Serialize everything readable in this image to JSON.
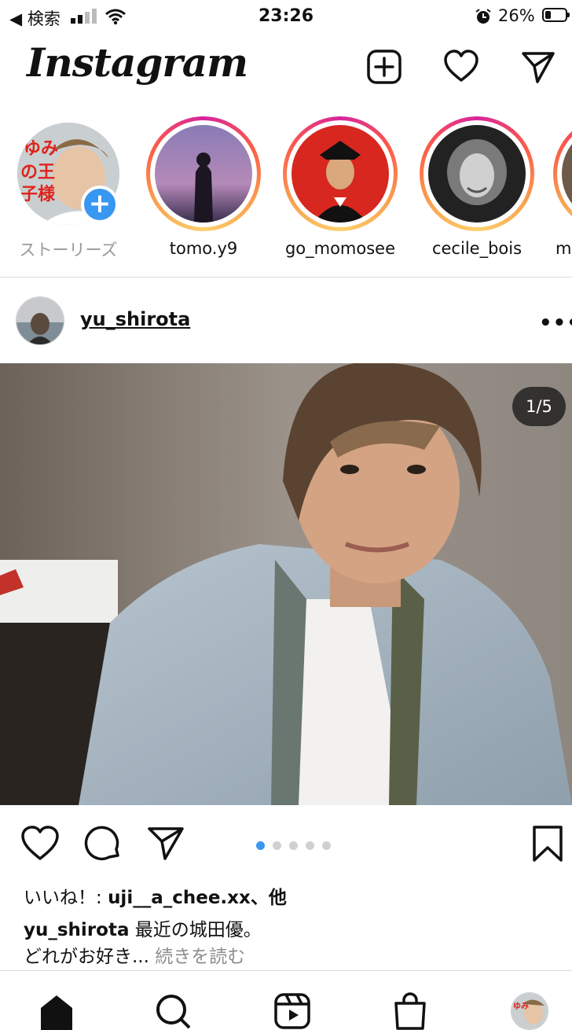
{
  "status_bar": {
    "back_label": "◀ 検索",
    "time": "23:26",
    "battery_percent": "26%"
  },
  "header": {
    "logo": "Instagram"
  },
  "stories": [
    {
      "name": "ストーリーズ",
      "own": true
    },
    {
      "name": "tomo.y9"
    },
    {
      "name": "go_momosee"
    },
    {
      "name": "cecile_bois"
    },
    {
      "name": "m"
    }
  ],
  "post": {
    "username": "yu_shirota",
    "more_label": "•••",
    "image_counter": "1/5",
    "carousel": {
      "count": 5,
      "active_index": 1
    },
    "likes_prefix": "いいね！: ",
    "likes_user": "uji__a_chee.xx",
    "likes_suffix": "、他",
    "caption_user": "yu_shirota",
    "caption_text": " 最近の城田優。",
    "caption_line2": "どれがお好き... ",
    "caption_more": "続きを読む"
  },
  "colors": {
    "accent": "#3897f0",
    "divider": "#dbdbdb",
    "muted": "#8e8e8e"
  },
  "icons": [
    "new-post-icon",
    "heart-icon",
    "direct-message-icon",
    "comment-icon",
    "share-icon",
    "bookmark-icon",
    "home-icon",
    "search-icon",
    "reels-icon",
    "shop-icon"
  ]
}
